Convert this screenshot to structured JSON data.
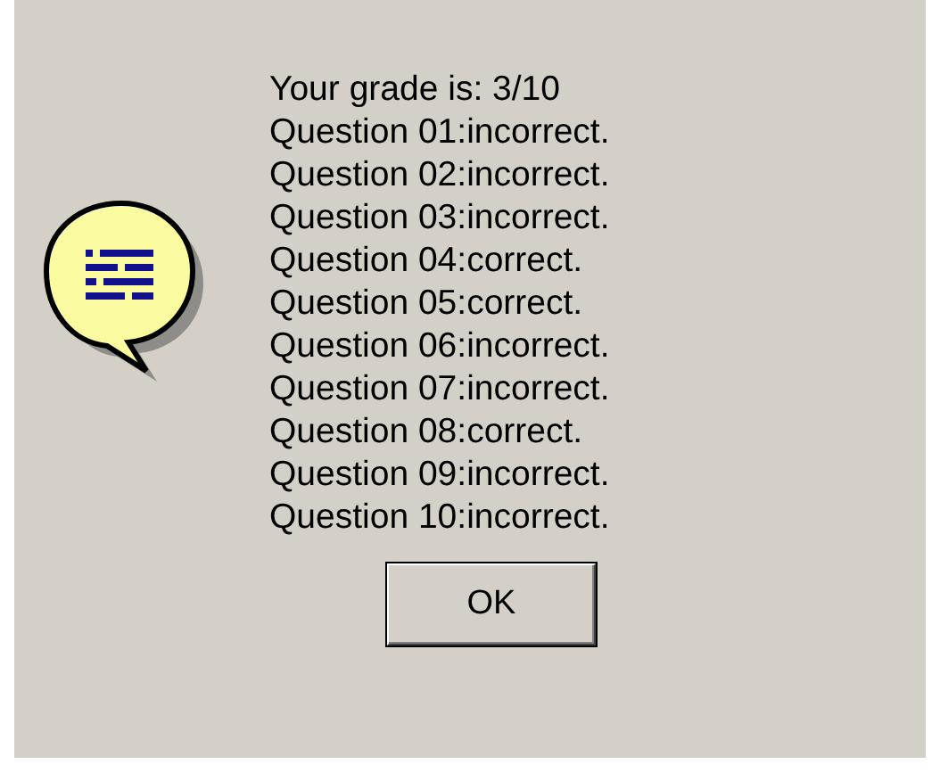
{
  "message_lines": [
    "Your grade is: 3/10",
    "Question 01:incorrect.",
    "Question 02:incorrect.",
    "Question 03:incorrect.",
    "Question 04:correct.",
    "Question 05:correct.",
    "Question 06:incorrect.",
    "Question 07:incorrect.",
    "Question 08:correct.",
    "Question 09:incorrect.",
    "Question 10:incorrect."
  ],
  "buttons": [
    "OK"
  ]
}
